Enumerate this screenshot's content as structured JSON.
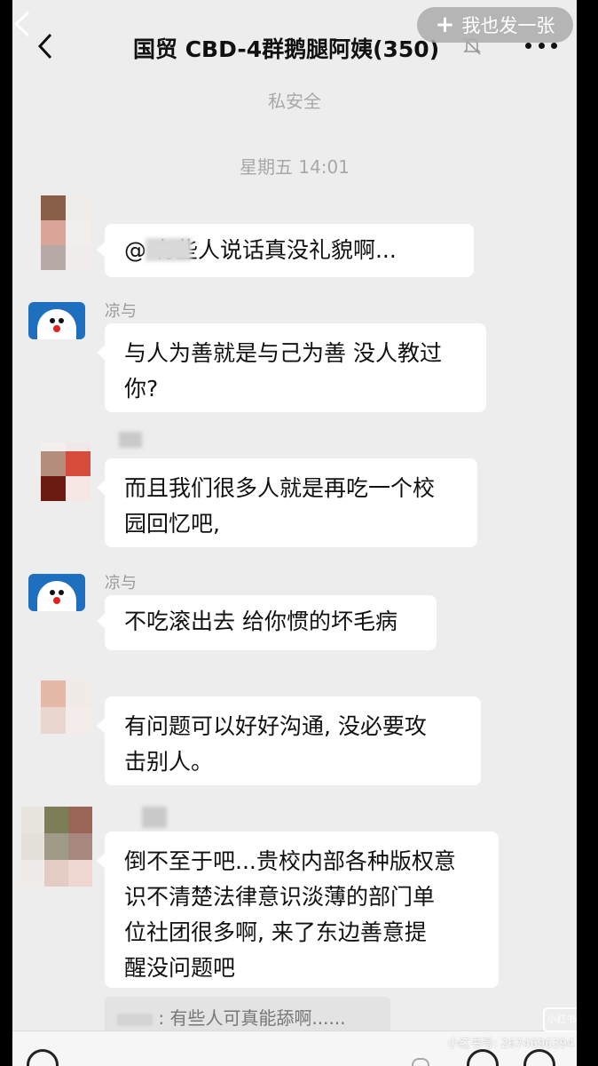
{
  "header": {
    "title": "国贸 CBD-4群鹅腿阿姨(350)",
    "share_button": "我也发一张"
  },
  "system_messages": {
    "notice": "私安全",
    "timestamp": "星期五 14:01"
  },
  "messages": [
    {
      "sender": "",
      "text": "@      有些人说话真没礼貌啊..."
    },
    {
      "sender": "凉与",
      "text_lines": [
        "与人为善就是与己为善 没人教过",
        "你?"
      ]
    },
    {
      "sender": "",
      "text_lines": [
        "而且我们很多人就是再吃一个校",
        "园回忆吧,"
      ]
    },
    {
      "sender": "凉与",
      "text": "不吃滚出去 给你惯的坏毛病"
    },
    {
      "sender": "",
      "text_lines": [
        "有问题可以好好沟通, 没必要攻",
        "击别人。"
      ]
    },
    {
      "sender": "",
      "text_lines": [
        "倒不至于吧...贵校内部各种版权意",
        "识不清楚法律意识淡薄的部门单",
        "位社团很多啊, 来了东边善意提",
        "醒没问题吧"
      ]
    }
  ],
  "quote": {
    "text": ": 有些人可真能舔啊......"
  },
  "watermark": {
    "text": "小红书号: 2674696394",
    "badge": "小红书"
  },
  "icons": [
    "back-arrow-icon",
    "mute-bell-icon",
    "more-dots-icon",
    "plus-icon",
    "voice-icon",
    "emoji-icon",
    "add-icon"
  ],
  "colors": {
    "background": "#ededed",
    "bubble": "#ffffff",
    "system_text": "#a8a8a8"
  }
}
